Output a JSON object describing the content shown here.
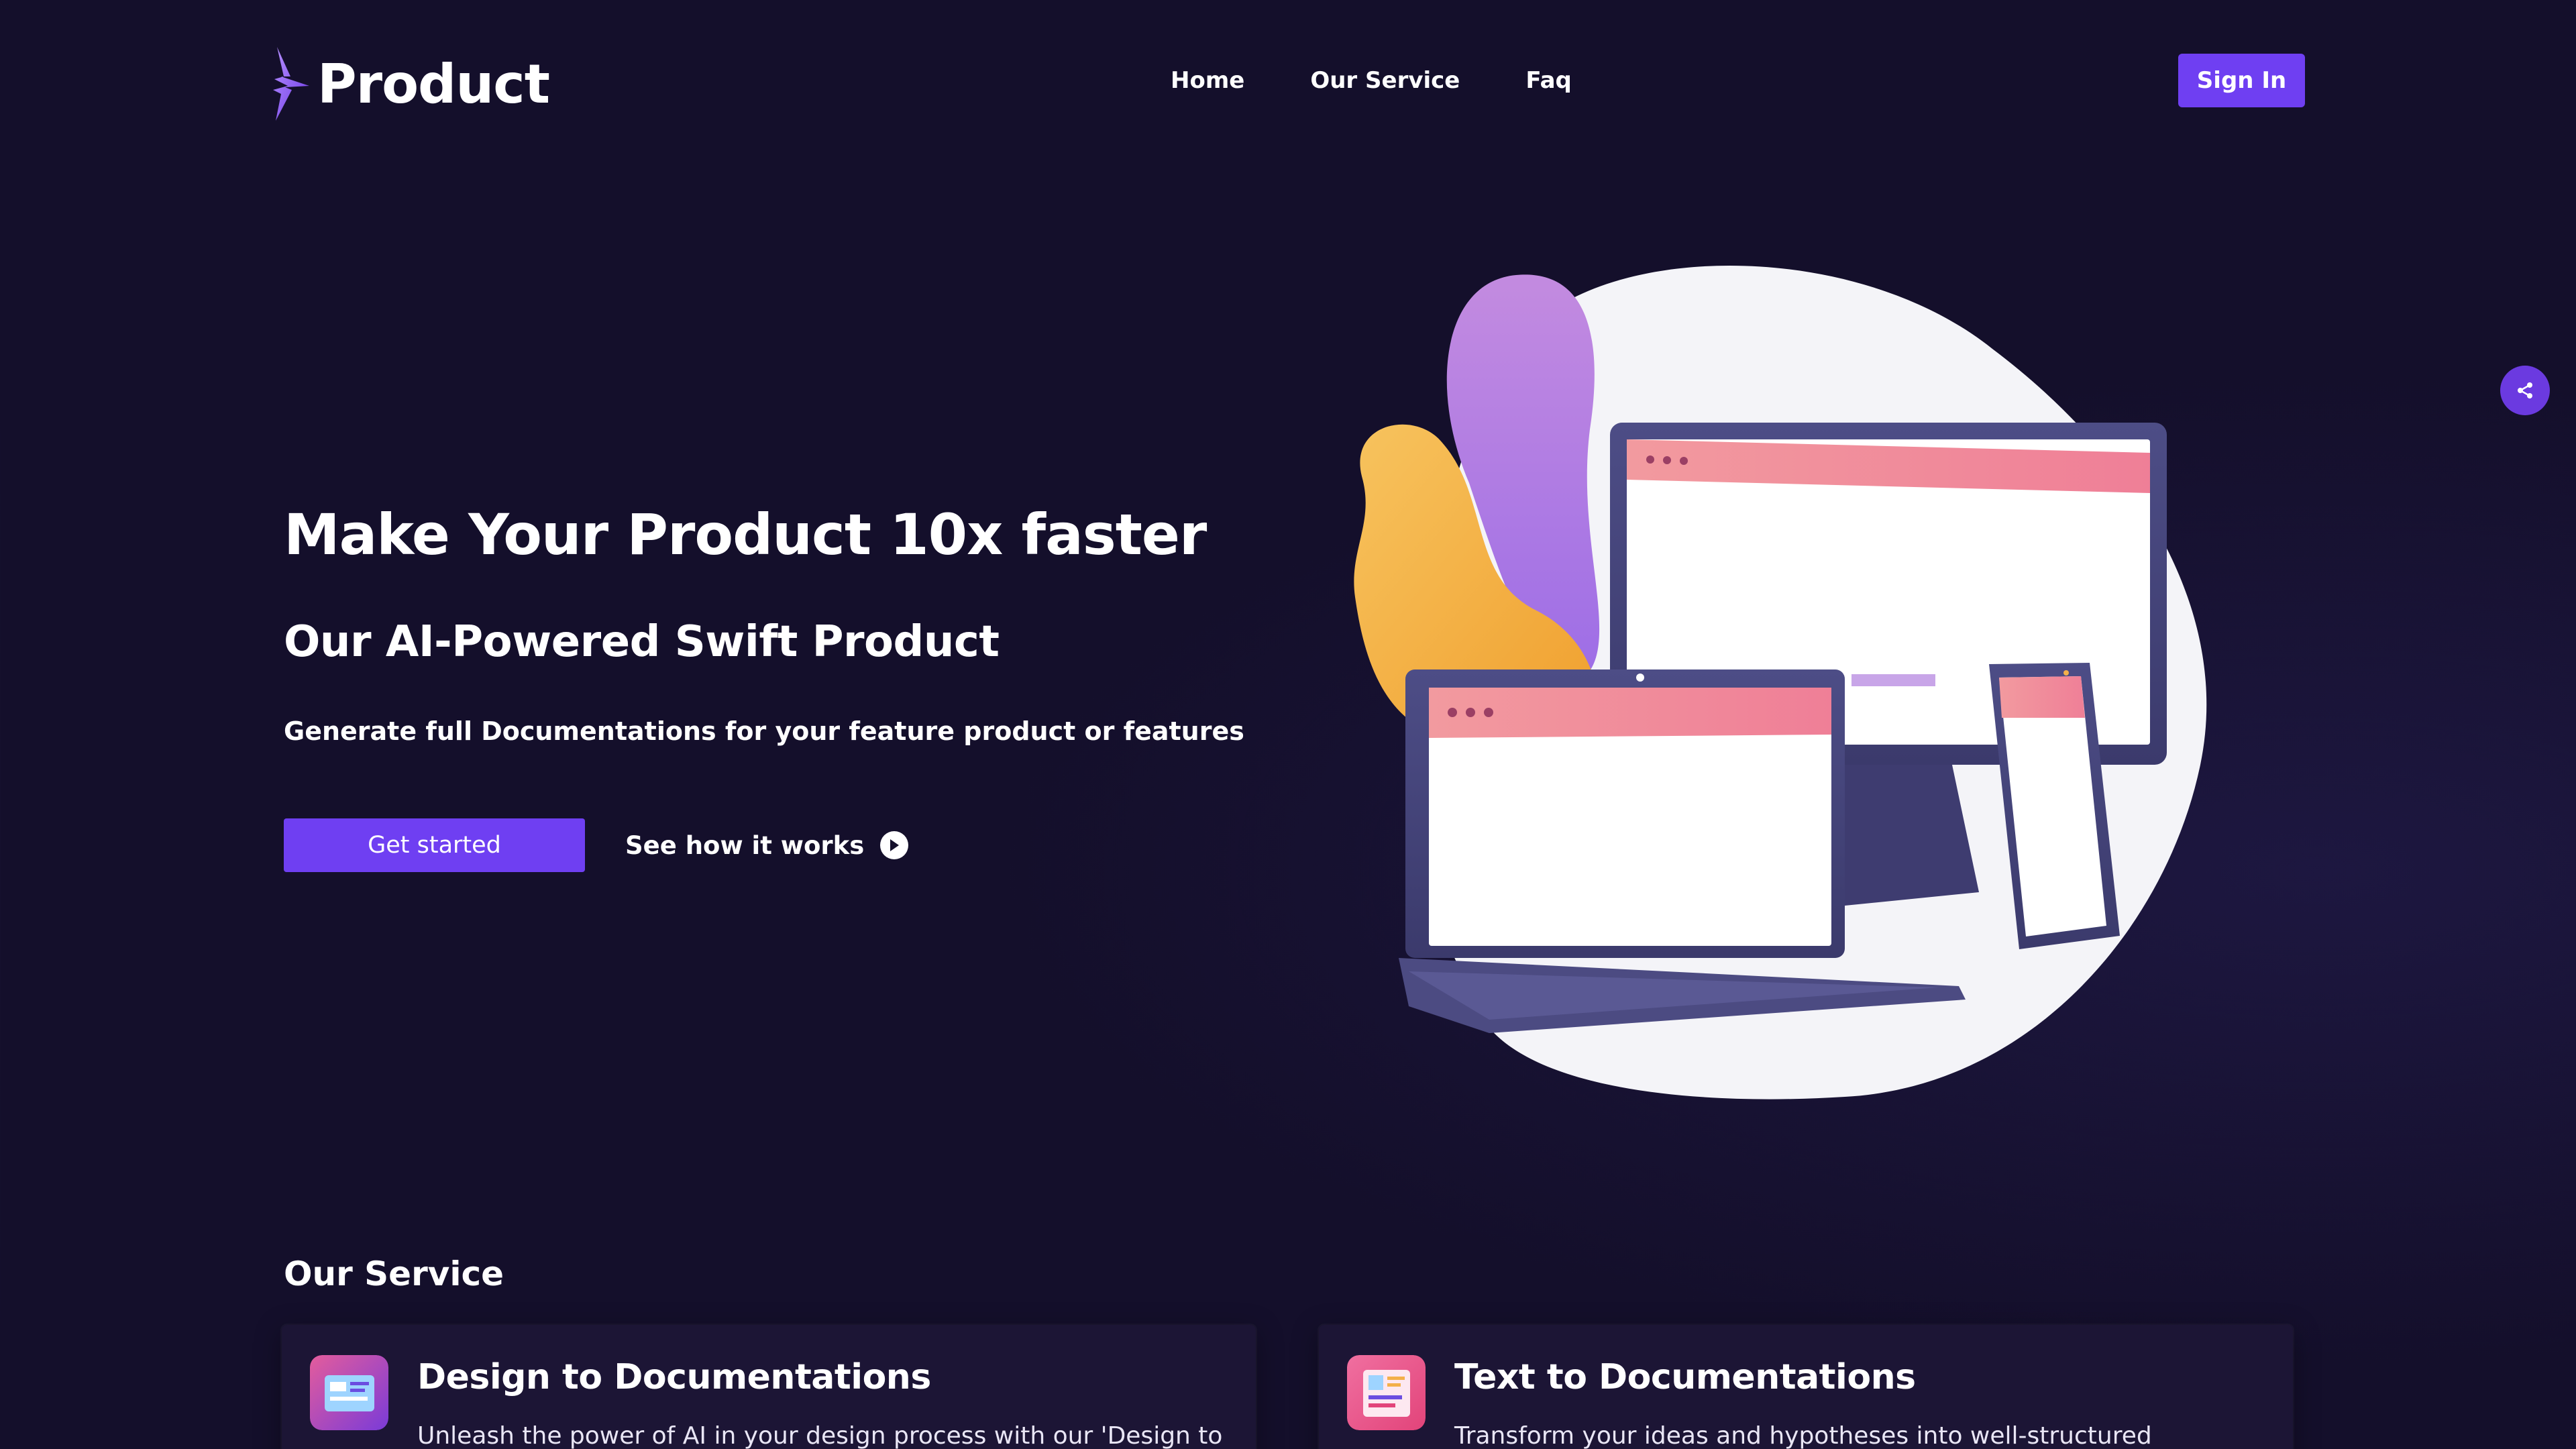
{
  "brand": {
    "name": "Product"
  },
  "nav": {
    "items": [
      {
        "label": "Home"
      },
      {
        "label": "Our Service"
      },
      {
        "label": "Faq"
      }
    ],
    "signin_label": "Sign In"
  },
  "hero": {
    "title": "Make Your Product 10x faster",
    "subtitle": "Our AI-Powered Swift Product",
    "description": "Generate full Documentations for your feature product or features",
    "primary_button": "Get started",
    "secondary_button": "See how it works"
  },
  "services": {
    "title": "Our Service",
    "cards": [
      {
        "title": "Design to Documentations",
        "text": "Unleash the power of AI in your design process with our 'Design to"
      },
      {
        "title": "Text to Documentations",
        "text": "Transform your ideas and hypotheses into well-structured"
      }
    ]
  },
  "icons": {
    "logo": "lightning-bolt-icon",
    "share": "share-icon",
    "play": "play-icon"
  },
  "colors": {
    "background": "#140f2b",
    "accent": "#6f3ff2",
    "share_button": "#6b3ae0"
  }
}
